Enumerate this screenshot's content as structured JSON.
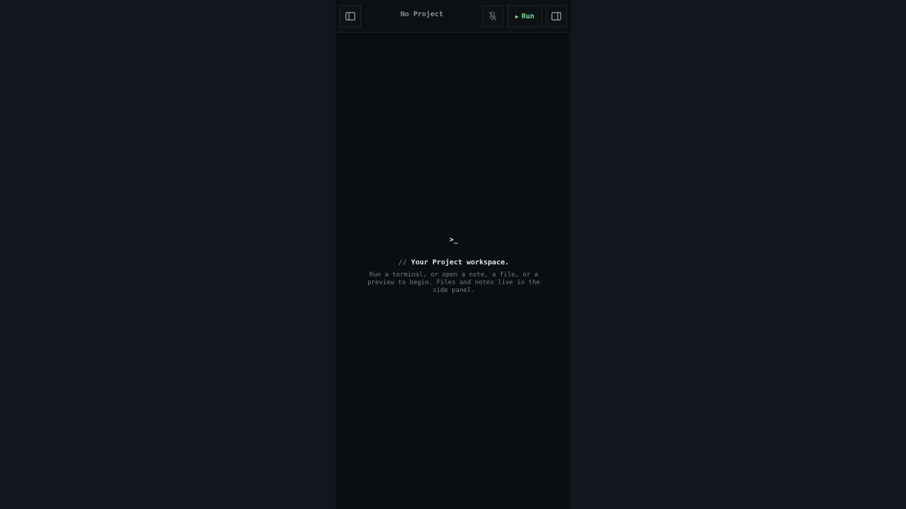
{
  "topbar": {
    "project_title": "No Project",
    "run_glyph": "▶",
    "run_label": "Run",
    "icons": {
      "left_panel": "sidebar-left-icon",
      "mic": "mic-off-icon",
      "right_panel": "sidebar-right-icon"
    }
  },
  "workspace": {
    "prompt": ">_",
    "headline_prefix": "//",
    "headline": "Your Project workspace.",
    "description": "Run a terminal, or open a note, a file, or a preview to begin. Files and notes live in the side panel."
  },
  "colors": {
    "page_bg": "#12161e",
    "app_bg": "#0a0e10",
    "accent_green": "#7fd99a",
    "muted_text": "#757c82"
  }
}
